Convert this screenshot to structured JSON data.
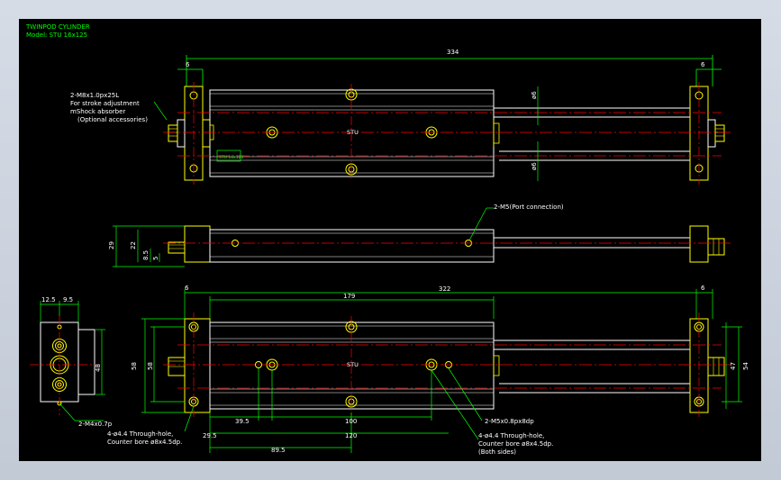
{
  "colors": {
    "background": "#000000",
    "outline": "#ffffff",
    "yellow": "#ffff00",
    "centerline": "#ff0000",
    "dimension": "#00ff00",
    "frame": "#c9d1dc"
  },
  "title": {
    "line1": "TWINPOD CYLINDER",
    "line2": "Model: STU 16x125"
  },
  "top_view": {
    "dim_overall": "334",
    "dim_left": "6",
    "dim_right": "6",
    "dim_rod1": "ø6",
    "dim_rod2": "ø6",
    "note_line1": "2-M8x1.0px25L",
    "note_line2": "For stroke adjustment",
    "note_line3": "mShock absorber",
    "note_line4": "(Optional accessories)",
    "label_center": "STU",
    "label_plate": "STU 16x125"
  },
  "side_view": {
    "port_note": "2-M5(Port connection)",
    "dim_29": "29",
    "dim_22": "22",
    "dim_85": "8.5",
    "dim_5": "5"
  },
  "bottom_view": {
    "dim_left": "6",
    "dim_right": "6",
    "dim_179": "179",
    "dim_322": "322",
    "dim_58": "58",
    "dim_47": "47",
    "dim_54": "54",
    "dim_39_5": "39.5",
    "dim_100": "100",
    "dim_29_5": "29.5",
    "dim_120": "120",
    "dim_89_5": "89.5",
    "note_m5": "2-M5x0.8px8dp",
    "note_through_left_1": "4-ø4.4 Through-hole,",
    "note_through_left_2": "Counter bore ø8x4.5dp.",
    "note_through_right_1": "4-ø4.4 Through-hole,",
    "note_through_right_2": "Counter bore ø8x4.5dp.",
    "note_through_right_3": "(Both sides)",
    "label_center": "STU"
  },
  "end_view": {
    "dim_12_5": "12.5",
    "dim_9_5": "9.5",
    "dim_48": "48",
    "note_m4": "2-M4x0.7p"
  }
}
